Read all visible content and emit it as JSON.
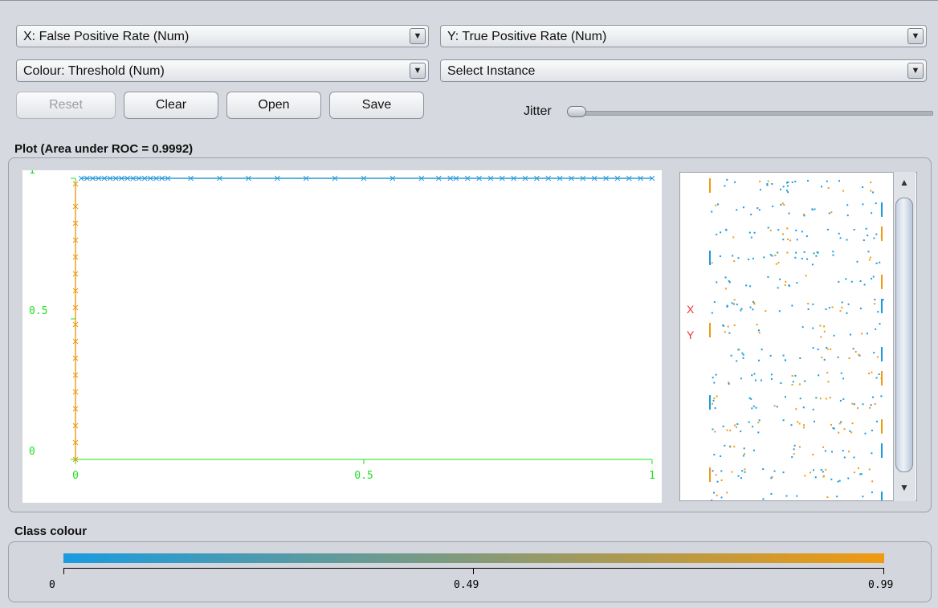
{
  "controls": {
    "x_axis_select": "X: False Positive Rate (Num)",
    "y_axis_select": "Y: True Positive Rate (Num)",
    "colour_select": "Colour: Threshold (Num)",
    "instance_select": "Select Instance",
    "reset_label": "Reset",
    "clear_label": "Clear",
    "open_label": "Open",
    "save_label": "Save",
    "jitter_label": "Jitter",
    "jitter_value": 0
  },
  "plot": {
    "title": "Plot (Area under ROC = 0.9992)"
  },
  "chart_data": {
    "type": "scatter",
    "title": "Plot (Area under ROC = 0.9992)",
    "xlabel": "False Positive Rate",
    "ylabel": "True Positive Rate",
    "xlim": [
      0,
      1
    ],
    "ylim": [
      0,
      1
    ],
    "x_ticks": [
      "0",
      "0.5",
      "1"
    ],
    "y_ticks": [
      "0",
      "0.5",
      "1"
    ],
    "axis_color": "#22e022",
    "colour_by": "Threshold",
    "series": [
      {
        "colour": "#f09a10",
        "x": [
          0,
          0,
          0,
          0,
          0,
          0,
          0,
          0,
          0,
          0,
          0,
          0,
          0,
          0,
          0,
          0,
          0
        ],
        "y": [
          0,
          0.06,
          0.12,
          0.18,
          0.24,
          0.3,
          0.36,
          0.42,
          0.48,
          0.54,
          0.6,
          0.66,
          0.72,
          0.78,
          0.84,
          0.9,
          0.98
        ]
      },
      {
        "colour": "#2a9ad8",
        "x": [
          0.01,
          0.02,
          0.03,
          0.04,
          0.05,
          0.06,
          0.07,
          0.08,
          0.09,
          0.1,
          0.11,
          0.12,
          0.13,
          0.14,
          0.15,
          0.16,
          0.2,
          0.25,
          0.3,
          0.35,
          0.4,
          0.45,
          0.5,
          0.55,
          0.6,
          0.63,
          0.65,
          0.66,
          0.68,
          0.7,
          0.72,
          0.74,
          0.76,
          0.78,
          0.8,
          0.82,
          0.84,
          0.86,
          0.88,
          0.9,
          0.92,
          0.94,
          0.96,
          0.98,
          1
        ],
        "y": [
          1,
          1,
          1,
          1,
          1,
          1,
          1,
          1,
          1,
          1,
          1,
          1,
          1,
          1,
          1,
          1,
          1,
          1,
          1,
          1,
          1,
          1,
          1,
          1,
          1,
          1,
          1,
          1,
          1,
          1,
          1,
          1,
          1,
          1,
          1,
          1,
          1,
          1,
          1,
          1,
          1,
          1,
          1,
          1,
          1
        ]
      }
    ]
  },
  "matrix": {
    "x_marker": "X",
    "y_marker": "Y"
  },
  "class_colour": {
    "title": "Class colour",
    "min_label": "0",
    "mid_label": "0.49",
    "max_label": "0.99",
    "low_colour": "#1a9be0",
    "high_colour": "#f09a10"
  }
}
